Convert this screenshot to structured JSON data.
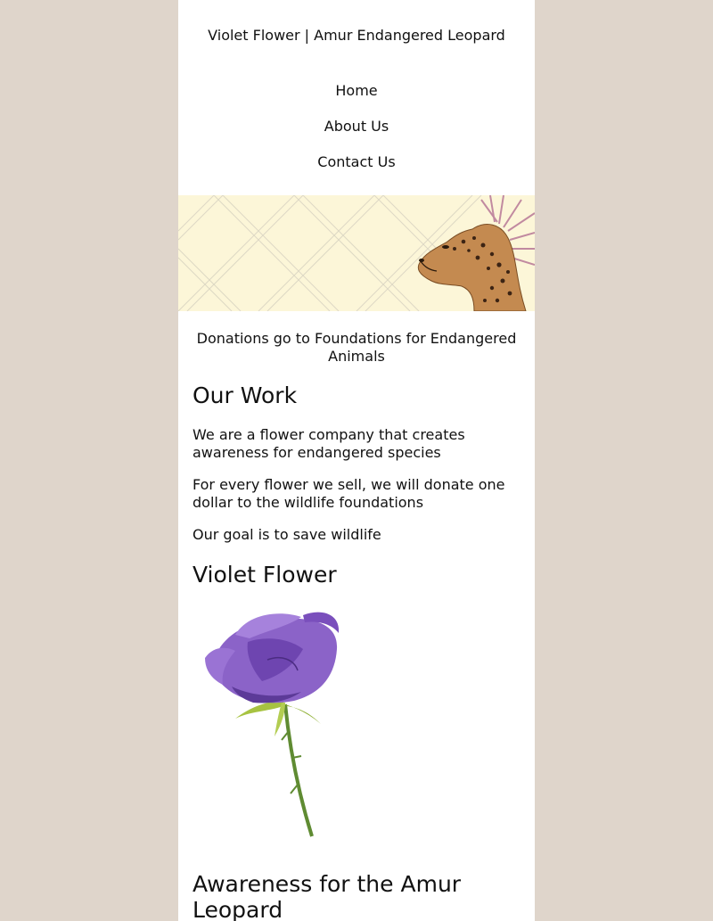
{
  "header": {
    "title": "Violet Flower | Amur Endangered Leopard"
  },
  "nav": {
    "items": [
      {
        "label": "Home"
      },
      {
        "label": "About Us"
      },
      {
        "label": "Contact Us"
      }
    ]
  },
  "banner": {
    "background_color": "#fcf6d8",
    "image": "leopard-illustration"
  },
  "main": {
    "tagline": "Donations go to Foundations for Endangered Animals",
    "our_work": {
      "heading": "Our Work",
      "paragraphs": [
        "We are a flower company that creates awareness for endangered species",
        "For every flower we sell, we will donate one dollar to the wildlife foundations",
        "Our goal is to save wildlife"
      ]
    },
    "violet_flower": {
      "heading": "Violet Flower",
      "image": "violet-rose-illustration"
    },
    "awareness": {
      "heading": "Awareness for the Amur Leopard"
    }
  },
  "colors": {
    "page_background": "#dfd5cb",
    "content_background": "#ffffff",
    "text": "#111111"
  }
}
